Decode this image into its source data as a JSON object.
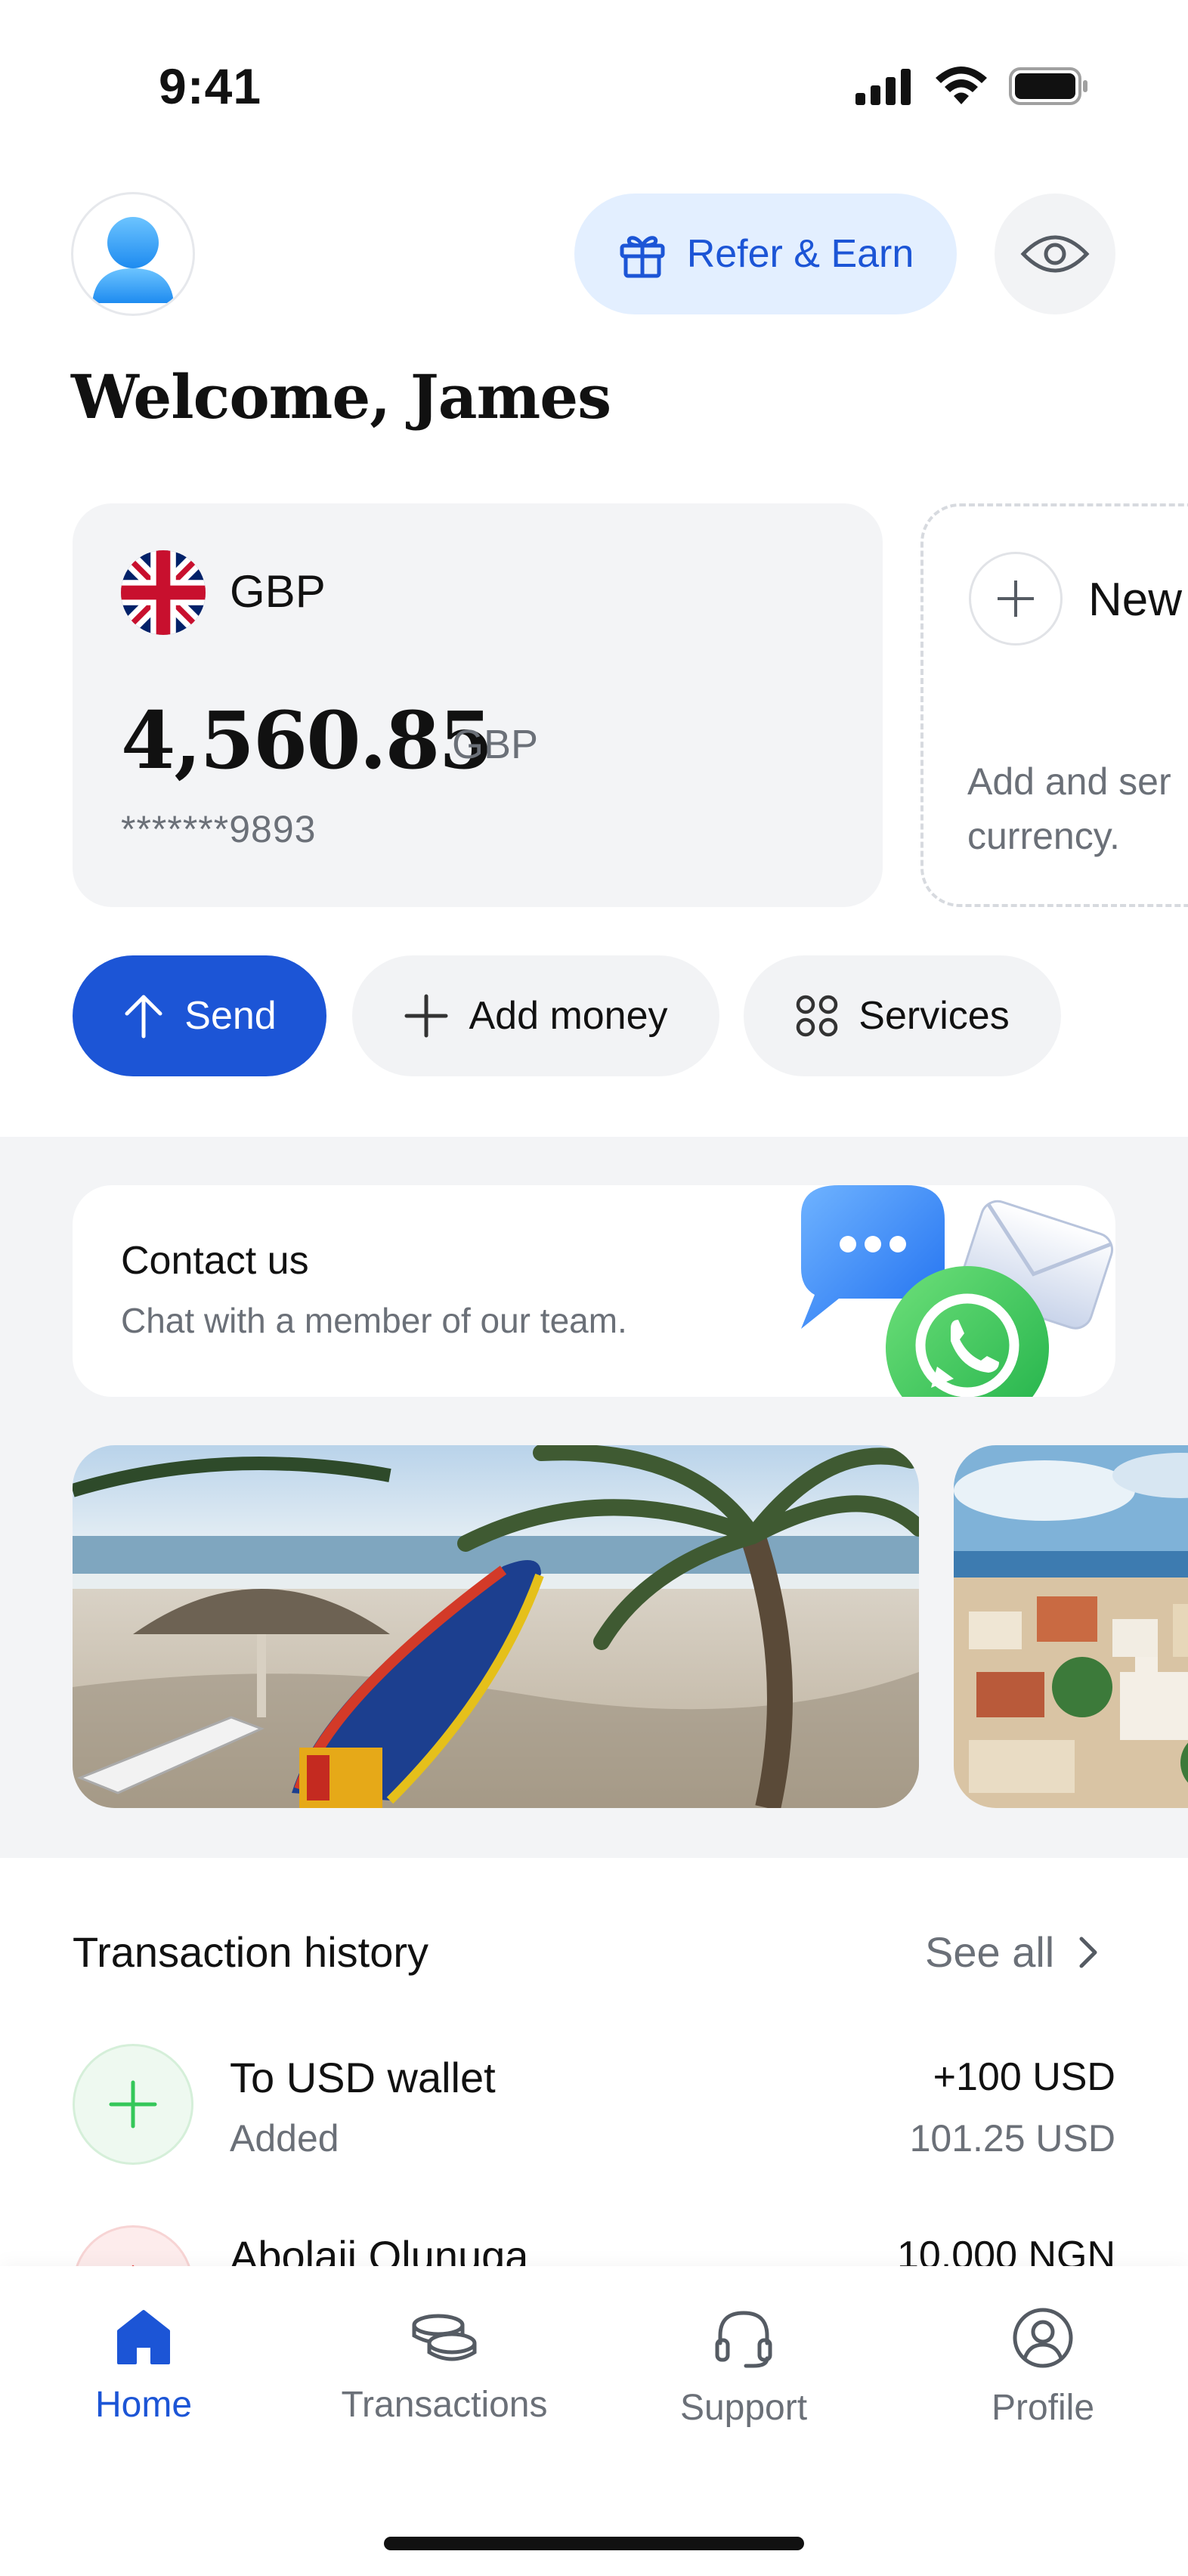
{
  "status_bar": {
    "time": "9:41"
  },
  "header": {
    "refer_label": "Refer & Earn",
    "welcome": "Welcome, James"
  },
  "balance_card": {
    "currency": "GBP",
    "amount": "4,560.85",
    "amount_currency": "GBP",
    "account_masked": "*******9893"
  },
  "new_card": {
    "label": "New",
    "description": "Add and ser currency."
  },
  "actions": {
    "send": "Send",
    "add_money": "Add money",
    "services": "Services"
  },
  "contact": {
    "title": "Contact us",
    "subtitle": "Chat with a member of our team."
  },
  "transactions": {
    "title": "Transaction history",
    "see_all": "See all",
    "items": [
      {
        "name": "To USD wallet",
        "status": "Added",
        "amount": "+100 USD",
        "balance": "101.25 USD"
      },
      {
        "name": "Abolaji Olunuga",
        "amount": "10,000 NGN"
      }
    ]
  },
  "nav": {
    "items": [
      {
        "label": "Home",
        "icon": "home-icon",
        "active": true
      },
      {
        "label": "Transactions",
        "icon": "coins-icon",
        "active": false
      },
      {
        "label": "Support",
        "icon": "headset-icon",
        "active": false
      },
      {
        "label": "Profile",
        "icon": "user-circle-icon",
        "active": false
      }
    ]
  },
  "colors": {
    "accent": "#1c55d6",
    "accent_light": "#e3efff",
    "surface": "#f3f4f6",
    "muted_text": "#6b7078",
    "positive": "#34c759"
  }
}
